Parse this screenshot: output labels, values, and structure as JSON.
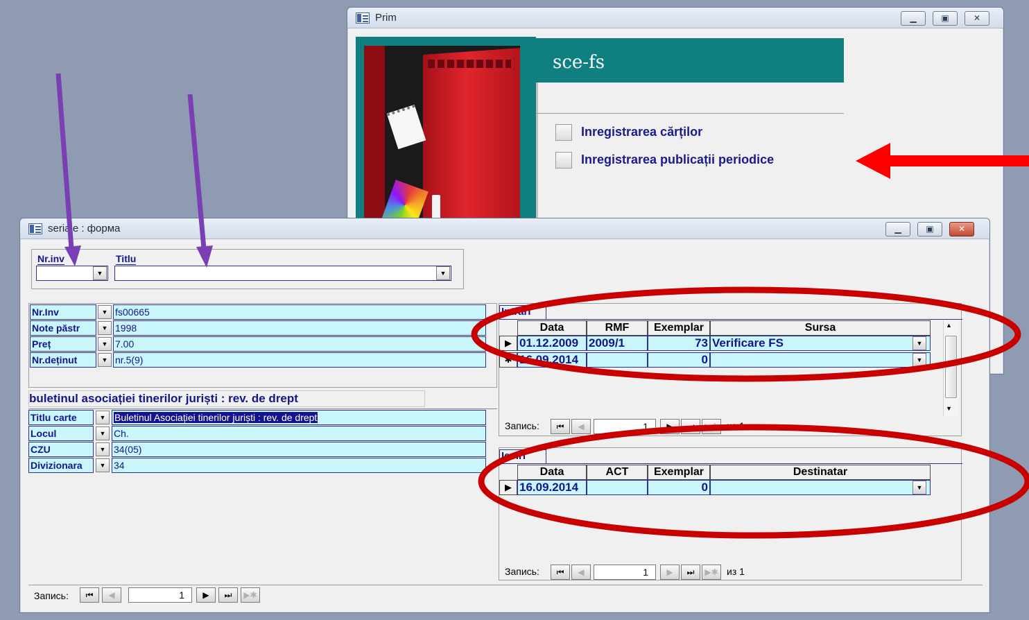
{
  "prim_window": {
    "title": "Prim",
    "heading": "sce-fs",
    "menu": [
      {
        "label": "Inregistrarea cărților"
      },
      {
        "label": "Inregistrarea publicații periodice"
      }
    ]
  },
  "form_window": {
    "title": "seriale : форма",
    "search": {
      "nrinv_label": "Nr.inv",
      "titlu_label": "Titlu"
    },
    "fields_top": [
      {
        "label": "Nr.Inv",
        "value": "fs00665"
      },
      {
        "label": "Note păstr",
        "value": "1998"
      },
      {
        "label": "Preț",
        "value": "7.00"
      },
      {
        "label": "Nr.deținut",
        "value": "nr.5(9)"
      }
    ],
    "summary_title": "buletinul asociației tinerilor juriști : rev. de drept",
    "fields_bottom": [
      {
        "label": "Titlu carte",
        "value": "Buletinul Asociației tinerilor juriști : rev. de drept"
      },
      {
        "label": "Locul",
        "value": "Ch."
      },
      {
        "label": "CZU",
        "value": "34(05)"
      },
      {
        "label": "Divizionara",
        "value": "34"
      }
    ],
    "intrari": {
      "tab_label": "Intrari",
      "columns": [
        "Data",
        "RMF",
        "Exemplar",
        "Sursa"
      ],
      "rows": [
        {
          "data": "01.12.2009",
          "rmf": "2009/1",
          "exemplar": "73",
          "sursa": "Verificare FS"
        },
        {
          "data": "16.09.2014",
          "rmf": "",
          "exemplar": "0",
          "sursa": ""
        }
      ],
      "nav": {
        "label": "Запись:",
        "current": "1",
        "of": "из 1"
      }
    },
    "iesiri": {
      "tab_label": "Iesiri",
      "columns": [
        "Data",
        "ACT",
        "Exemplar",
        "Destinatar"
      ],
      "rows": [
        {
          "data": "16.09.2014",
          "act": "",
          "exemplar": "0",
          "destinatar": ""
        }
      ],
      "nav": {
        "label": "Запись:",
        "current": "1",
        "of": "из 1"
      }
    },
    "main_nav": {
      "label": "Запись:",
      "current": "1"
    }
  },
  "colors": {
    "teal": "#0f7f7f",
    "field_bg": "#c9f6fb",
    "field_text": "#14148c",
    "annotation_red": "#c80000",
    "annotation_purple": "#7a3fb5",
    "red_arrow": "#ff0000"
  },
  "icons": [
    "window-icon",
    "minimize-icon",
    "restore-icon",
    "close-icon",
    "dropdown-icon",
    "first-record-icon",
    "prev-record-icon",
    "next-record-icon",
    "last-record-icon",
    "new-record-icon",
    "row-selector-icon"
  ]
}
